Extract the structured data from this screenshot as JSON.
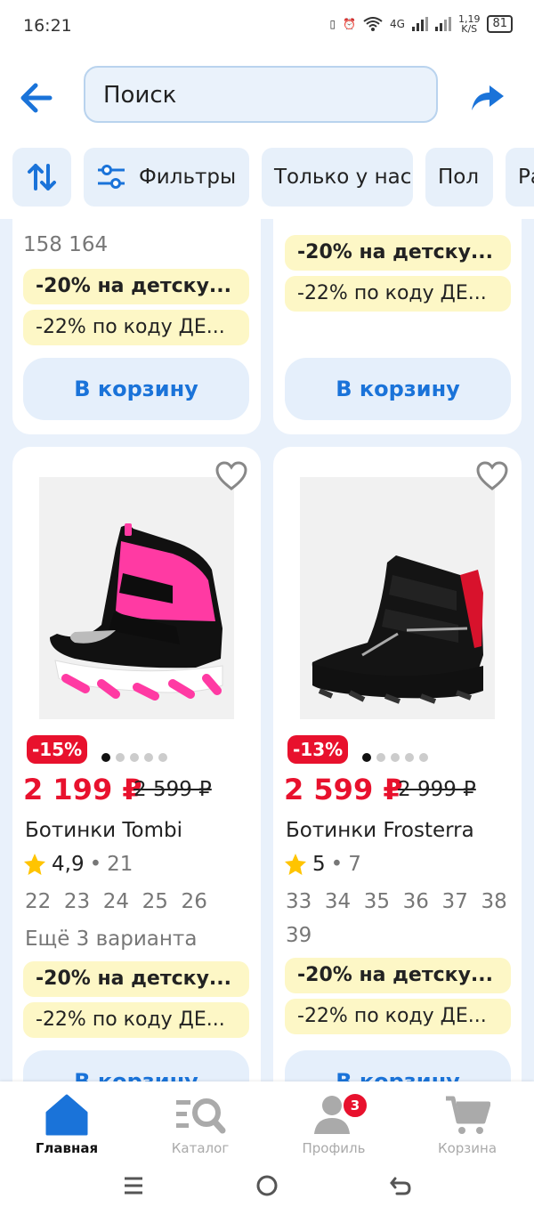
{
  "status_bar": {
    "time": "16:21",
    "network": "4G",
    "speed": "1,19",
    "speed_unit": "K/S",
    "battery": "81"
  },
  "search": {
    "value": "Поиск"
  },
  "chips": [
    {
      "label": "",
      "icon": "sort-icon"
    },
    {
      "label": "Фильтры",
      "icon": "filter-icon"
    },
    {
      "label": "Только у нас"
    },
    {
      "label": "Пол"
    },
    {
      "label": "Ра"
    }
  ],
  "top_cards": [
    {
      "sizes": "158 164",
      "promo1": "-20% на детску...",
      "promo2": "-22% по коду ДЕ...",
      "cart": "В корзину"
    },
    {
      "promo1": "-20% на детску...",
      "promo2": "-22% по коду ДЕ...",
      "cart": "В корзину"
    }
  ],
  "products": [
    {
      "discount": "-15%",
      "price": "2 199 ₽",
      "old_price": "2 599 ₽",
      "title": "Ботинки Tombi",
      "rating": "4,9",
      "reviews": "21",
      "sizes": "22  23  24  25  26",
      "variants": "Ещё 3 варианта",
      "promo1": "-20% на детску...",
      "promo2": "-22% по коду ДЕ...",
      "cart": "В корзину"
    },
    {
      "discount": "-13%",
      "price": "2 599 ₽",
      "old_price": "2 999 ₽",
      "title": "Ботинки Frosterra",
      "rating": "5",
      "reviews": "7",
      "sizes": "33  34  35  36  37  38",
      "sizes2": "39",
      "promo1": "-20% на детску...",
      "promo2": "-22% по коду ДЕ...",
      "cart": "В корзину"
    }
  ],
  "nav": [
    {
      "label": "Главная",
      "icon": "home-icon"
    },
    {
      "label": "Каталог",
      "icon": "catalog-icon"
    },
    {
      "label": "Профиль",
      "icon": "profile-icon",
      "badge": "3"
    },
    {
      "label": "Корзина",
      "icon": "cart-icon"
    }
  ],
  "colors": {
    "accent": "#1a73d9",
    "price": "#e8112d",
    "promo_bg": "#fdf7c6",
    "page_bg": "#e9f1fb"
  }
}
